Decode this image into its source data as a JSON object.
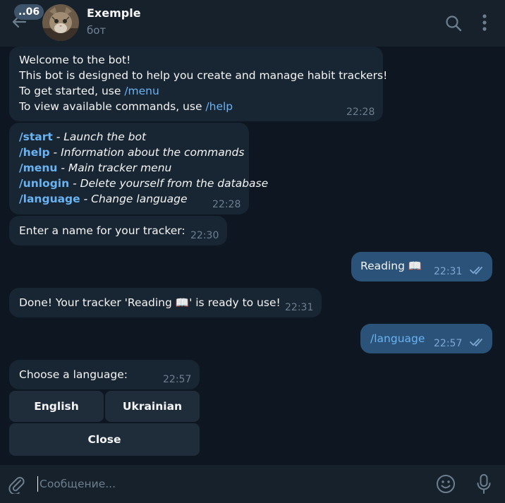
{
  "header": {
    "unread_count": "..06",
    "title": "Exemple",
    "subtitle": "бот"
  },
  "messages": [
    {
      "lines": [
        "Welcome to the bot!",
        "This bot is designed to help you create and manage habit trackers!",
        "To get started, use ",
        "/menu",
        "To view available commands, use ",
        "/help"
      ],
      "time": "22:28"
    },
    {
      "commands": [
        {
          "cmd": "/start",
          "desc": " - Launch the bot"
        },
        {
          "cmd": "/help",
          "desc": " - Information about the commands"
        },
        {
          "cmd": "/menu",
          "desc": " - Main tracker menu"
        },
        {
          "cmd": "/unlogin",
          "desc": " - Delete yourself from the database"
        },
        {
          "cmd": "/language",
          "desc": " - Change language"
        }
      ],
      "time": "22:28"
    },
    {
      "text": "Enter a name for your tracker:",
      "time": "22:30"
    },
    {
      "text": "Reading 📖",
      "time": "22:31"
    },
    {
      "text": "Done! Your tracker 'Reading 📖' is ready to use!",
      "time": "22:31"
    },
    {
      "text": "/language",
      "time": "22:57"
    },
    {
      "text": "Choose a language:",
      "time": "22:57"
    }
  ],
  "keyboard": {
    "english": "English",
    "ukrainian": "Ukrainian",
    "close": "Close"
  },
  "composer": {
    "placeholder": "Сообщение..."
  },
  "icons": {
    "back": "back-arrow-icon",
    "search": "search-icon",
    "more": "more-vertical-icon",
    "attach": "paperclip-icon",
    "emoji": "emoji-icon",
    "mic": "microphone-icon",
    "read": "double-check-icon"
  },
  "colors": {
    "background": "#0e1621",
    "header": "#17212b",
    "incoming_bubble": "#182533",
    "outgoing_bubble": "#2b5278",
    "link": "#6ab3f3",
    "time_text": "#6d7f8f"
  }
}
